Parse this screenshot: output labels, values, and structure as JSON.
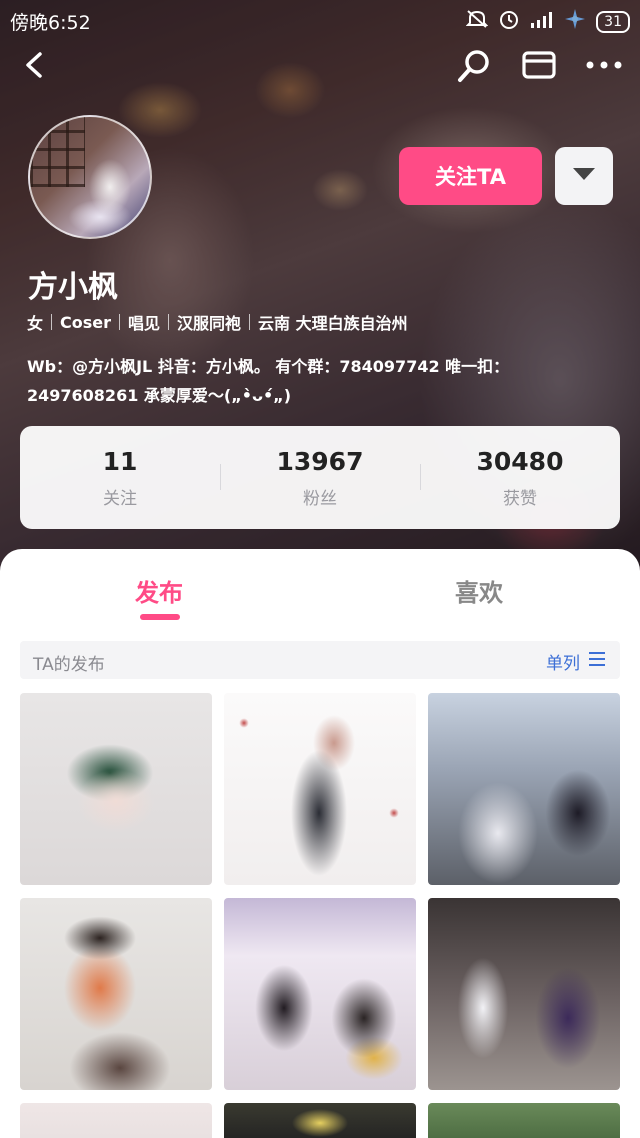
{
  "status_bar": {
    "time": "傍晚6:52",
    "battery": "31",
    "icons": [
      "mute-icon",
      "alarm-icon",
      "signal-icon",
      "wifi-icon",
      "battery-icon"
    ]
  },
  "nav": {
    "icons": [
      "back-icon",
      "search-icon",
      "mail-icon",
      "more-icon"
    ]
  },
  "profile": {
    "name": "方小枫",
    "tags": [
      "女",
      "Coser",
      "唱见",
      "汉服同袍",
      "云南 大理白族自治州"
    ],
    "bio_line1": "Wb：@方小枫JL   抖音：方小枫。 有个群：784097742   唯一扣：",
    "bio_line2": "2497608261   承蒙厚爱～(„•̀ᴗ•́„)"
  },
  "actions": {
    "follow_label": "关注TA"
  },
  "stats": [
    {
      "value": "11",
      "label": "关注"
    },
    {
      "value": "13967",
      "label": "粉丝"
    },
    {
      "value": "30480",
      "label": "获赞"
    }
  ],
  "tabs": {
    "publish": "发布",
    "like": "喜欢",
    "active": "publish"
  },
  "section": {
    "title": "TA的发布",
    "view_toggle": "单列"
  },
  "colors": {
    "accent": "#ff4b86",
    "link": "#3c6fd6"
  }
}
